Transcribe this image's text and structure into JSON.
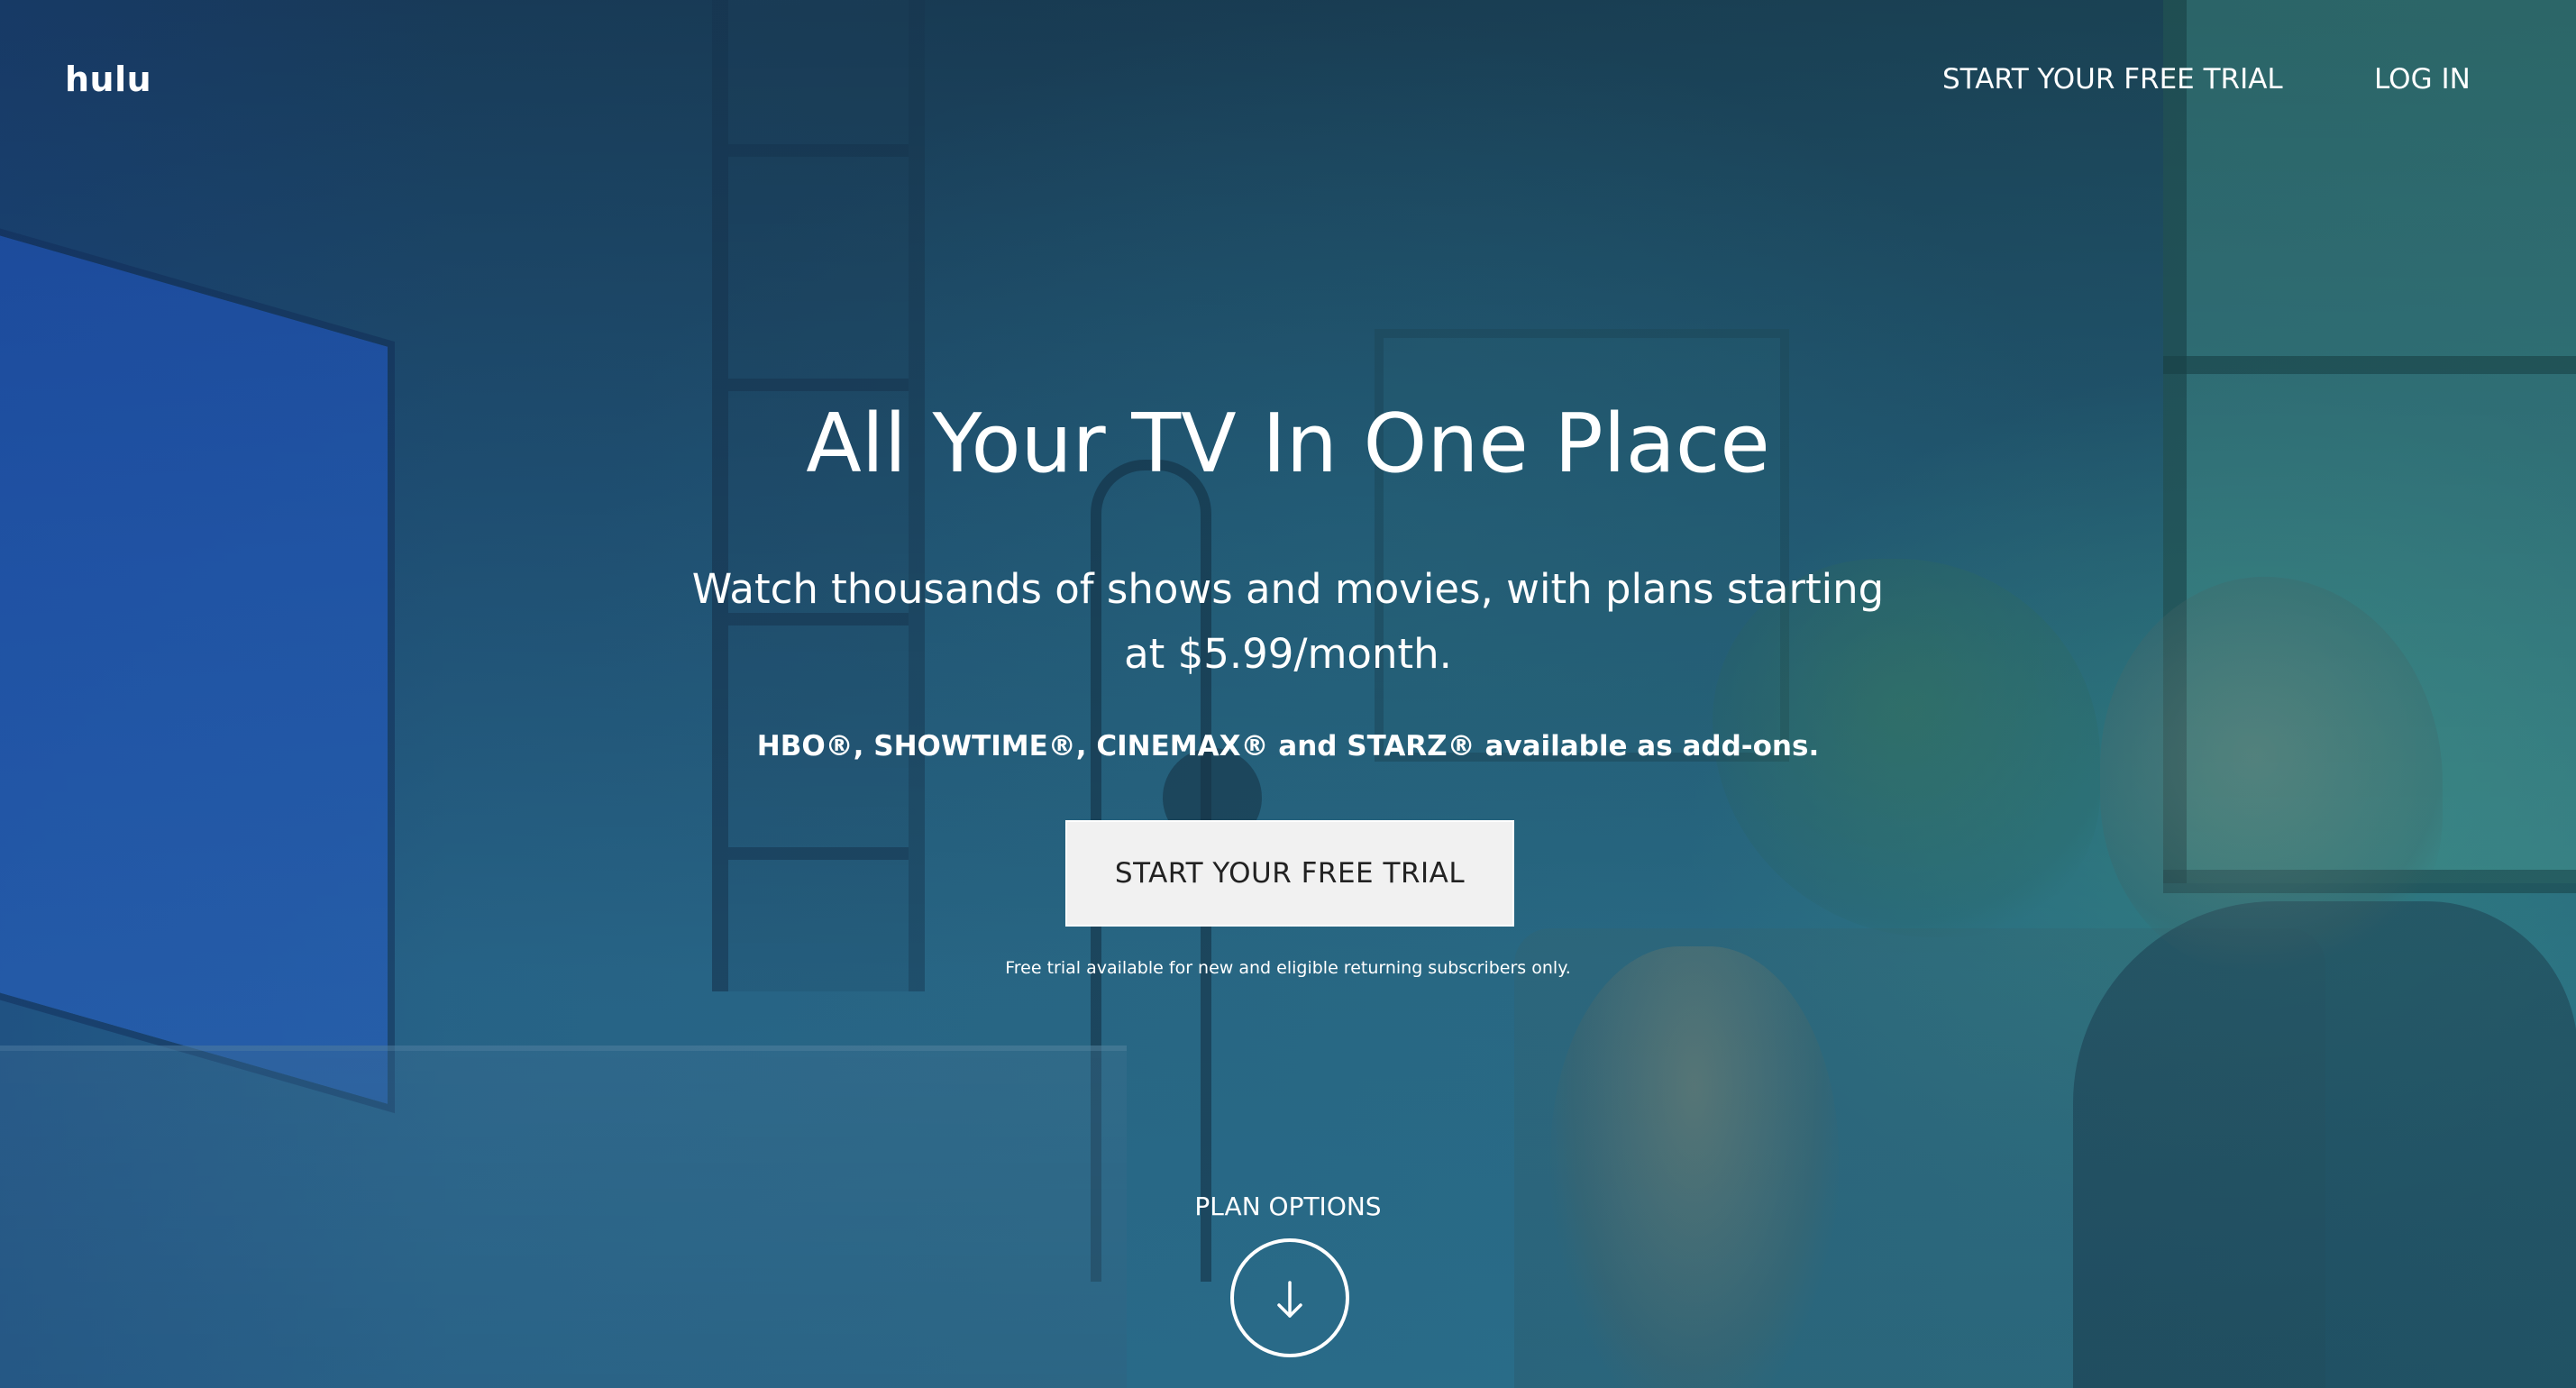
{
  "header": {
    "logo": "hulu",
    "nav": {
      "trial_label": "START YOUR FREE TRIAL",
      "login_label": "LOG IN"
    }
  },
  "hero": {
    "headline": "All Your TV In One Place",
    "subhead_line1": "Watch thousands of shows and movies, with plans starting",
    "subhead_line2": "at $5.99/month.",
    "addons": "HBO®, SHOWTIME®, CINEMAX® and STARZ® available as add-ons.",
    "cta_label": "START YOUR FREE TRIAL",
    "disclaimer": "Free trial available for new and eligible returning subscribers only."
  },
  "plans": {
    "label": "PLAN OPTIONS",
    "icon": "arrow-down-icon"
  },
  "colors": {
    "background_top": "#17364a",
    "background_bottom": "#2b6f8c",
    "cta_background": "#f1f1f1",
    "cta_text": "#222222",
    "text": "#ffffff"
  }
}
